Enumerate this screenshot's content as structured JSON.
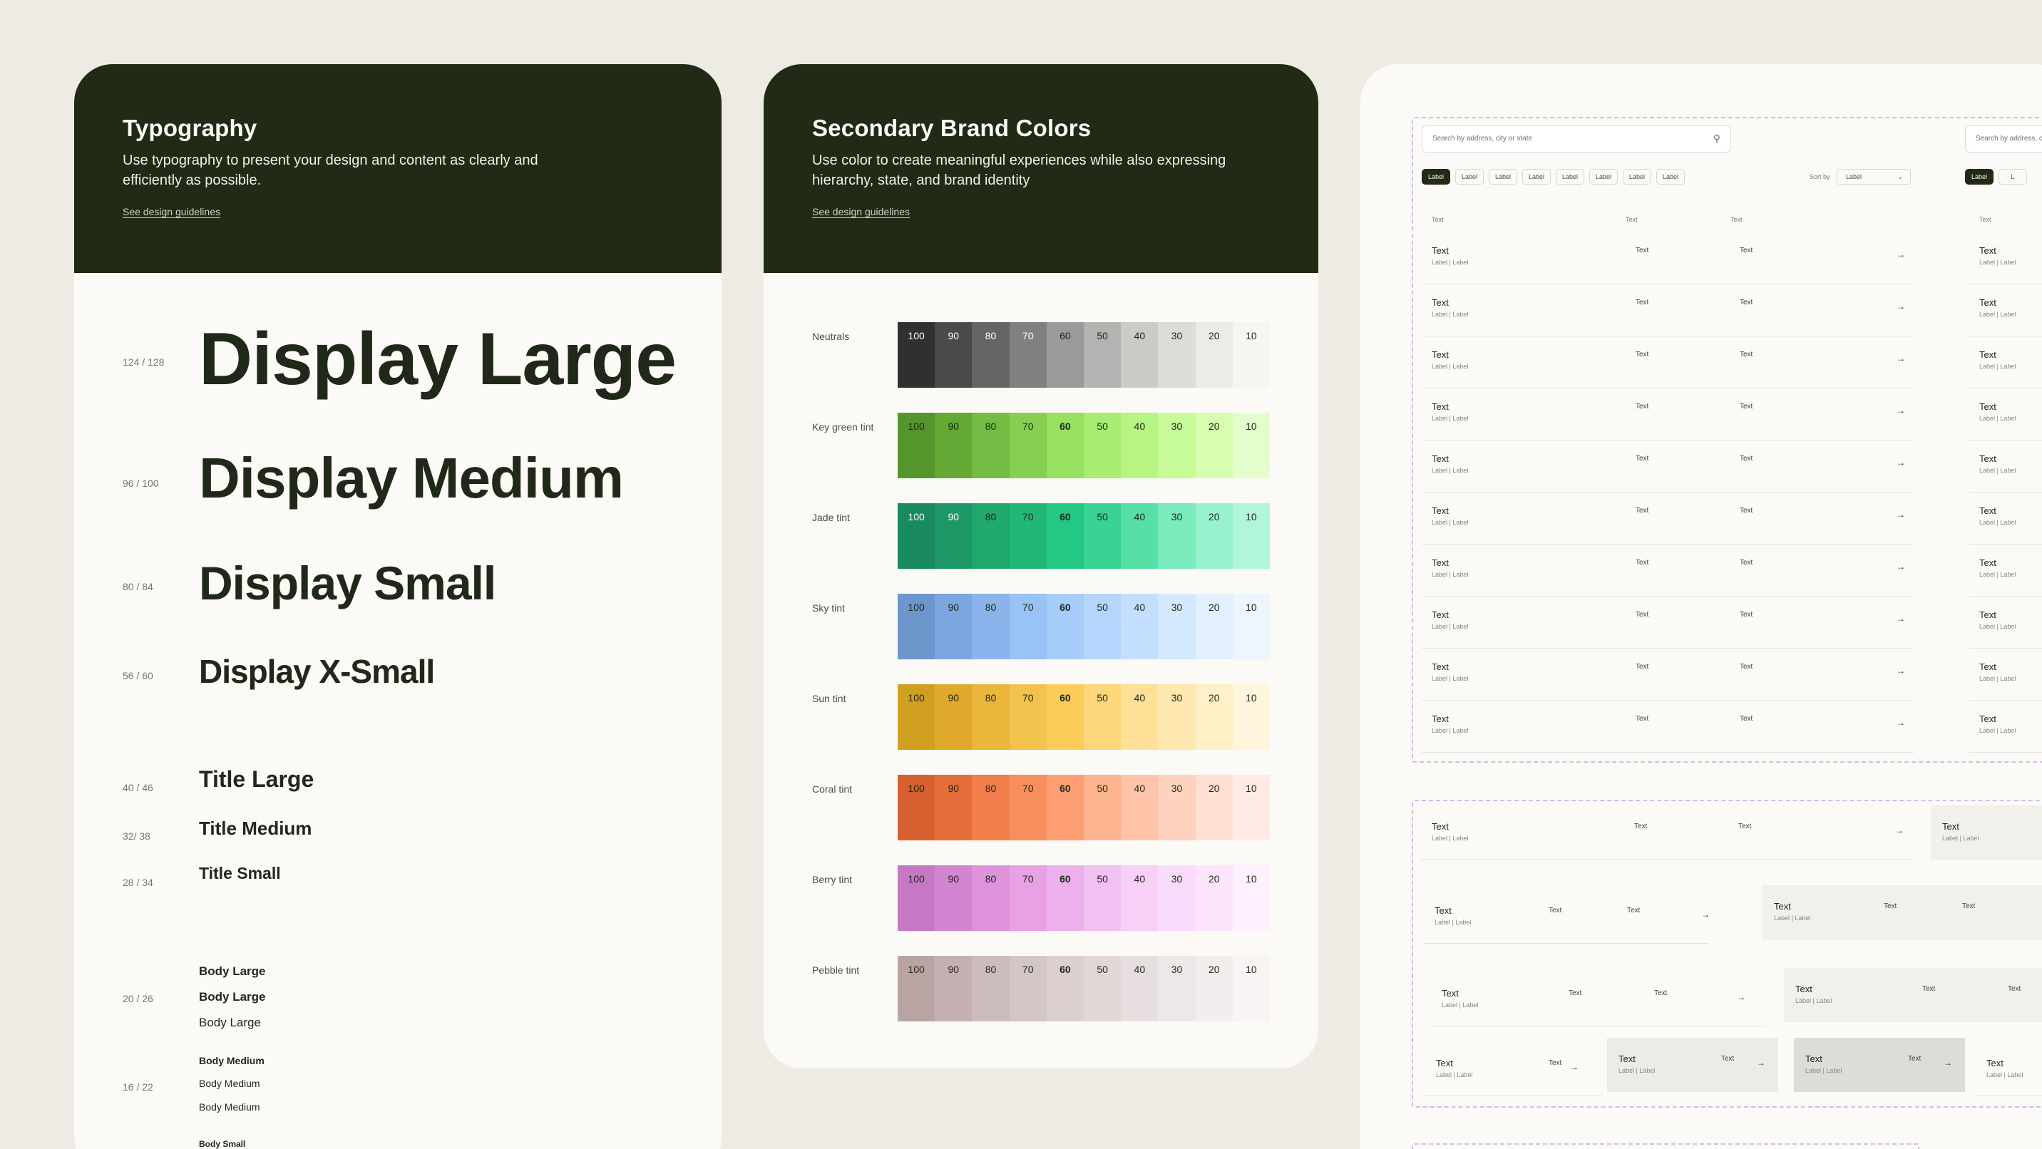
{
  "typography": {
    "title": "Typography",
    "description": "Use typography to present your design and content as clearly and efficiently as possible.",
    "link": "See design guidelines",
    "styles": [
      {
        "size": "124 / 128",
        "label": "Display Large"
      },
      {
        "size": "96 / 100",
        "label": "Display Medium"
      },
      {
        "size": "80 / 84",
        "label": "Display Small"
      },
      {
        "size": "56 / 60",
        "label": "Display X-Small"
      },
      {
        "size": "40 / 46",
        "label": "Title Large"
      },
      {
        "size": "32/ 38",
        "label": "Title Medium"
      },
      {
        "size": "28 / 34",
        "label": "Title Small"
      }
    ],
    "body_groups": [
      {
        "size": "20 / 26",
        "items": [
          "Body Large",
          "Body Large",
          "Body Large"
        ]
      },
      {
        "size": "16 / 22",
        "items": [
          "Body Medium",
          "Body Medium",
          "Body Medium"
        ]
      },
      {
        "size": "",
        "items": [
          "Body Small"
        ]
      }
    ]
  },
  "colors": {
    "title": "Secondary Brand Colors",
    "description": "Use color to create meaningful experiences while also expressing hierarchy, state, and brand identity",
    "link": "See design guidelines",
    "steps": [
      "100",
      "90",
      "80",
      "70",
      "60",
      "50",
      "40",
      "30",
      "20",
      "10"
    ],
    "palettes": [
      {
        "name": "Neutrals",
        "colors": [
          "#303030",
          "#4a4a4a",
          "#656565",
          "#808080",
          "#9a9a9a",
          "#b3b3b1",
          "#cbcbc8",
          "#dcdcd8",
          "#ebebe7",
          "#f5f5f1"
        ]
      },
      {
        "name": "Key green tint",
        "colors": [
          "#55962c",
          "#64a935",
          "#74bc44",
          "#86cf52",
          "#98e060",
          "#a8ec72",
          "#b7f583",
          "#c7fb97",
          "#d6fdb0",
          "#e3fecb"
        ]
      },
      {
        "name": "Jade tint",
        "colors": [
          "#198a5e",
          "#1d9866",
          "#20a86e",
          "#22b779",
          "#25c785",
          "#38d395",
          "#57dfa7",
          "#79ebbd",
          "#97f2cd",
          "#b2f6da"
        ]
      },
      {
        "name": "Sky tint",
        "colors": [
          "#6d96cc",
          "#7ca6df",
          "#8bb4ec",
          "#99c2f5",
          "#a6cdfa",
          "#b5d6fc",
          "#c4dffd",
          "#d4e8fe",
          "#e2f0ff",
          "#edf5ff"
        ]
      },
      {
        "name": "Sun tint",
        "colors": [
          "#d19f20",
          "#dfaa2b",
          "#eab63c",
          "#f2c24c",
          "#fbcd58",
          "#fdd77a",
          "#fee097",
          "#ffe8b0",
          "#fff0c8",
          "#fff5dc"
        ]
      },
      {
        "name": "Coral tint",
        "colors": [
          "#d6602f",
          "#e66e3b",
          "#f17e4b",
          "#f98e5d",
          "#fd9f72",
          "#feb38f",
          "#ffc4a9",
          "#ffd2bf",
          "#ffe0d3",
          "#ffebe3"
        ]
      },
      {
        "name": "Berry tint",
        "colors": [
          "#c678c4",
          "#d485d2",
          "#df93dc",
          "#e8a1e5",
          "#eeb0ec",
          "#f3c0f2",
          "#f8cff7",
          "#fbdbfb",
          "#fde6fd",
          "#fef0fe"
        ]
      },
      {
        "name": "Pebble tint",
        "colors": [
          "#b9a4a4",
          "#c4b0b0",
          "#cdbcbc",
          "#d4c6c6",
          "#dbcfcf",
          "#e1d7d7",
          "#e7dfdf",
          "#ede7e7",
          "#f3eeee",
          "#f8f4f4"
        ]
      }
    ],
    "light_text_steps": 4,
    "bold_step": "60"
  },
  "components": {
    "search_placeholder": "Search by address, city or state",
    "search_placeholder_2": "Search by address, c",
    "chips": [
      "Label",
      "Label",
      "Label",
      "Label",
      "Label",
      "Label",
      "Label",
      "Label"
    ],
    "chips_2": [
      "Label",
      "L"
    ],
    "sort_label": "Sort by",
    "sort_value": "Label",
    "col_headers": [
      "Text",
      "Text",
      "Text"
    ],
    "col_header_2": "Text",
    "row": {
      "main": "Text",
      "sub": "Label  |  Label",
      "c2": "Text",
      "c3": "Text",
      "arrow": "→"
    },
    "row_count": 10
  }
}
